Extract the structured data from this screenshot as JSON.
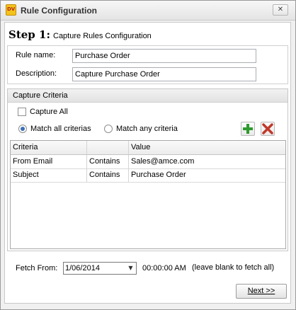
{
  "window": {
    "title": "Rule Configuration",
    "icon": "app-logo-icon"
  },
  "step": {
    "number": "Step 1:",
    "description": "Capture Rules Configuration"
  },
  "rule": {
    "name_label": "Rule name:",
    "name_value": "Purchase Order",
    "description_label": "Description:",
    "description_value": "Capture Purchase Order"
  },
  "criteria": {
    "header": "Capture Criteria",
    "capture_all_label": "Capture All",
    "capture_all_checked": false,
    "match_all_label": "Match all criterias",
    "match_any_label": "Match any criteria",
    "selected_match": "all",
    "add_icon": "add-plus-icon",
    "delete_icon": "delete-x-icon",
    "columns": [
      "Criteria",
      "",
      "Value"
    ],
    "rows": [
      {
        "field": "From Email",
        "operator": "Contains",
        "value": "Sales@amce.com"
      },
      {
        "field": "Subject",
        "operator": "Contains",
        "value": "Purchase Order"
      }
    ]
  },
  "fetch": {
    "label": "Fetch From:",
    "date": "1/06/2014",
    "time": "00:00:00 AM",
    "hint": "(leave blank to fetch all)"
  },
  "buttons": {
    "next_label": "Next >>",
    "close_glyph": "✕"
  },
  "colors": {
    "add_green": "#2e9b2e",
    "delete_red": "#c0392b",
    "radio_blue": "#3b6fb5"
  }
}
